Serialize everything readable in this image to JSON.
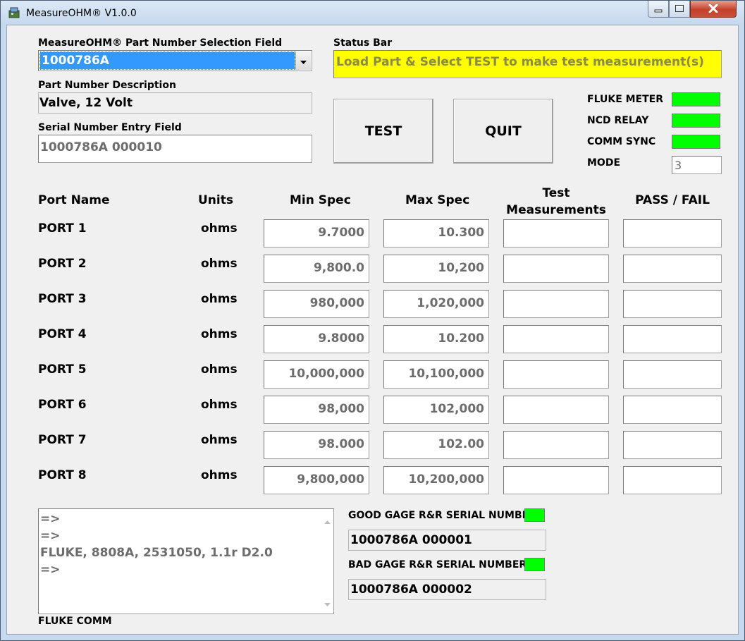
{
  "window": {
    "title": "MeasureOHM® V1.0.0"
  },
  "part_selection": {
    "label": "MeasureOHM® Part Number Selection Field",
    "value": "1000786A"
  },
  "status_bar": {
    "label": "Status Bar",
    "text": "Load Part & Select TEST to make test measurement(s)",
    "color": "#ffff00"
  },
  "description": {
    "label": "Part Number Description",
    "value": "Valve, 12 Volt"
  },
  "serial_entry": {
    "label": "Serial Number Entry Field",
    "value": "1000786A 000010"
  },
  "buttons": {
    "test": "TEST",
    "quit": "QUIT"
  },
  "indicators": [
    {
      "label": "FLUKE METER",
      "color": "#00ff00"
    },
    {
      "label": "NCD RELAY",
      "color": "#00ff00"
    },
    {
      "label": "COMM SYNC",
      "color": "#00ff00"
    }
  ],
  "mode": {
    "label": "MODE",
    "value": "3"
  },
  "table": {
    "headers": {
      "port": "Port Name",
      "units": "Units",
      "min": "Min Spec",
      "max": "Max Spec",
      "test_line1": "Test",
      "test_line2": "Measurements",
      "passfail": "PASS / FAIL"
    },
    "rows": [
      {
        "port": "PORT 1",
        "units": "ohms",
        "min": "9.7000",
        "max": "10.300",
        "measurement": "",
        "result": ""
      },
      {
        "port": "PORT 2",
        "units": "ohms",
        "min": "9,800.0",
        "max": "10,200",
        "measurement": "",
        "result": ""
      },
      {
        "port": "PORT 3",
        "units": "ohms",
        "min": "980,000",
        "max": "1,020,000",
        "measurement": "",
        "result": ""
      },
      {
        "port": "PORT 4",
        "units": "ohms",
        "min": "9.8000",
        "max": "10.200",
        "measurement": "",
        "result": ""
      },
      {
        "port": "PORT 5",
        "units": "ohms",
        "min": "10,000,000",
        "max": "10,100,000",
        "measurement": "",
        "result": ""
      },
      {
        "port": "PORT 6",
        "units": "ohms",
        "min": "98,000",
        "max": "102,000",
        "measurement": "",
        "result": ""
      },
      {
        "port": "PORT 7",
        "units": "ohms",
        "min": "98.000",
        "max": "102.00",
        "measurement": "",
        "result": ""
      },
      {
        "port": "PORT 8",
        "units": "ohms",
        "min": "9,800,000",
        "max": "10,200,000",
        "measurement": "",
        "result": ""
      }
    ]
  },
  "log": {
    "lines": [
      "=>",
      "=>",
      "FLUKE, 8808A, 2531050, 1.1r D2.0",
      "=>"
    ],
    "label": "FLUKE COMM"
  },
  "good_gage": {
    "label": "GOOD GAGE R&R SERIAL NUMBER",
    "value": "1000786A 000001",
    "color": "#00ff00"
  },
  "bad_gage": {
    "label": "BAD GAGE R&R SERIAL NUMBER",
    "value": "1000786A 000002",
    "color": "#00ff00"
  },
  "icons": [
    "app-icon",
    "minimize-icon",
    "maximize-icon",
    "close-icon",
    "dropdown-arrow-icon",
    "scroll-up-icon",
    "scroll-down-icon"
  ]
}
